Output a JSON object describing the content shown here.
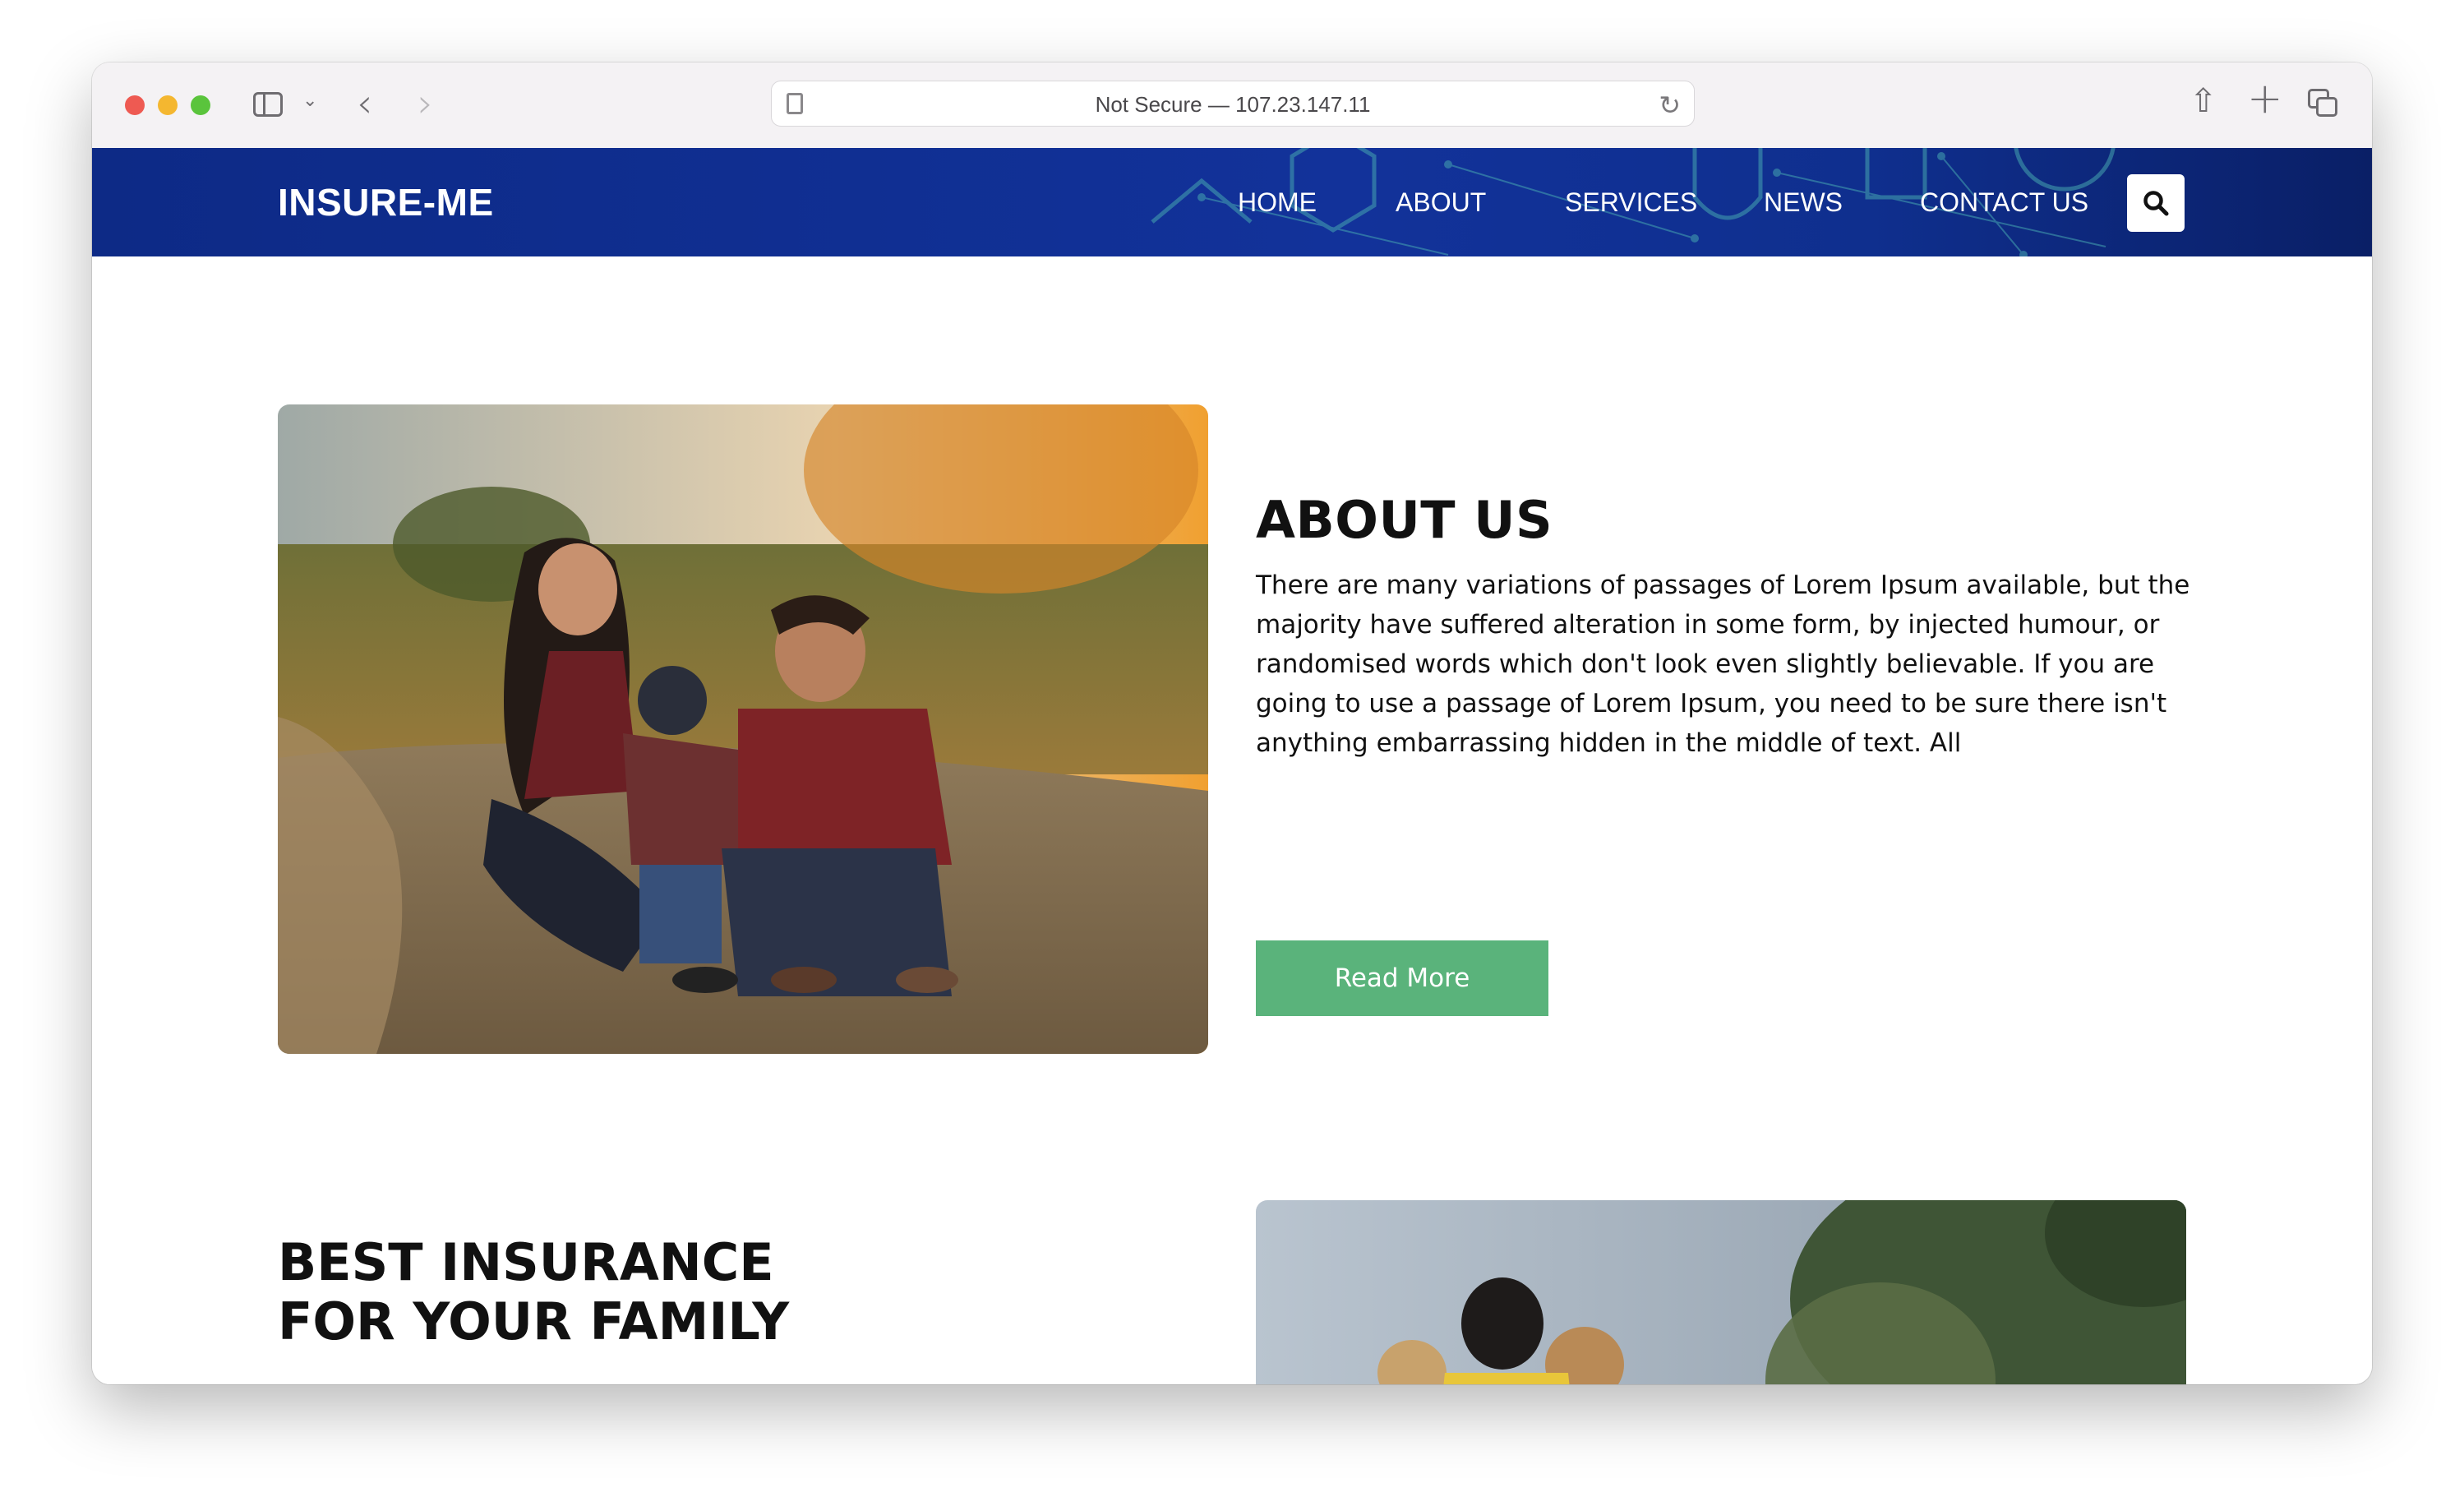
{
  "browser": {
    "address": "Not Secure — 107.23.147.11"
  },
  "site": {
    "logo": "INSURE-ME",
    "nav": [
      "HOME",
      "ABOUT",
      "SERVICES",
      "NEWS",
      "CONTACT US"
    ],
    "brand_color": "#12329a",
    "accent_color": "#5ab37b"
  },
  "about": {
    "title": "ABOUT US",
    "text": "There are many variations of passages of Lorem Ipsum available, but the majority have suffered alteration in some form, by injected humour, or randomised words which don't look even slightly believable. If you are going to use a passage of Lorem Ipsum, you need to be sure there isn't anything embarrassing hidden in the middle of text. All",
    "button": "Read More"
  },
  "family": {
    "title": "BEST INSURANCE FOR YOUR FAMILY"
  }
}
